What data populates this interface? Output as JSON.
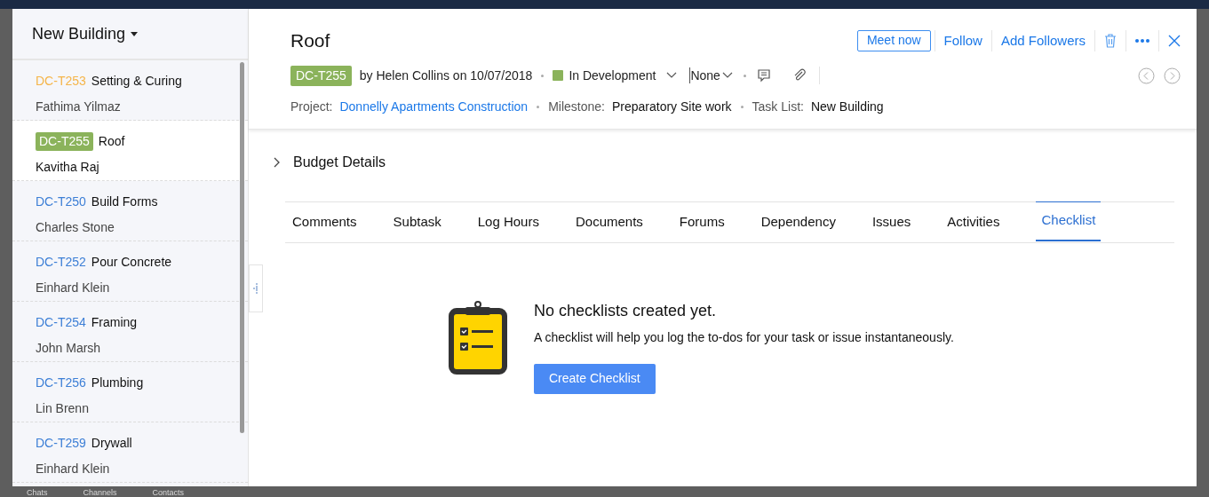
{
  "sidebar": {
    "title": "New Building",
    "items": [
      {
        "id": "DC-T253",
        "name": "Setting & Curing",
        "owner": "Fathima Yilmaz",
        "color": "#f5b54a",
        "selected": false
      },
      {
        "id": "DC-T255",
        "name": "Roof",
        "owner": "Kavitha Raj",
        "color": "#8bb35b",
        "selected": true
      },
      {
        "id": "DC-T250",
        "name": "Build Forms",
        "owner": "Charles Stone",
        "color": "#3d7fd6",
        "selected": false
      },
      {
        "id": "DC-T252",
        "name": "Pour Concrete",
        "owner": "Einhard Klein",
        "color": "#3d7fd6",
        "selected": false
      },
      {
        "id": "DC-T254",
        "name": "Framing",
        "owner": "John Marsh",
        "color": "#3d7fd6",
        "selected": false
      },
      {
        "id": "DC-T256",
        "name": "Plumbing",
        "owner": "Lin Brenn",
        "color": "#3d7fd6",
        "selected": false
      },
      {
        "id": "DC-T259",
        "name": "Drywall",
        "owner": "Einhard Klein",
        "color": "#3d7fd6",
        "selected": false
      }
    ]
  },
  "task": {
    "title": "Roof",
    "id": "DC-T255",
    "byline": "by Helen Collins on 10/07/2018",
    "status": {
      "label": "In Development",
      "color": "#8bb35b"
    },
    "priority": "None",
    "actions": [
      "Meet now",
      "Follow",
      "Add Followers"
    ],
    "meta": [
      {
        "label": "Project:",
        "value": "Donnelly Apartments Construction",
        "kind": "link"
      },
      {
        "label": "Milestone:",
        "value": "Preparatory Site work",
        "kind": "text"
      },
      {
        "label": "Task List:",
        "value": "New Building",
        "kind": "text"
      }
    ]
  },
  "budget": {
    "label": "Budget Details",
    "expanded": false
  },
  "tabs": [
    {
      "label": "Comments",
      "selected": false
    },
    {
      "label": "Subtask",
      "selected": false
    },
    {
      "label": "Log Hours",
      "selected": false
    },
    {
      "label": "Documents",
      "selected": false
    },
    {
      "label": "Forums",
      "selected": false
    },
    {
      "label": "Dependency",
      "selected": false
    },
    {
      "label": "Issues",
      "selected": false
    },
    {
      "label": "Activities",
      "selected": false
    },
    {
      "label": "Checklist",
      "selected": true
    }
  ],
  "empty_state": {
    "title": "No checklists created yet.",
    "message": "A checklist will help you log the to-dos for your task or issue instantaneously.",
    "button": "Create Checklist"
  },
  "background_nav": [
    "Chats",
    "Channels",
    "Contacts"
  ]
}
